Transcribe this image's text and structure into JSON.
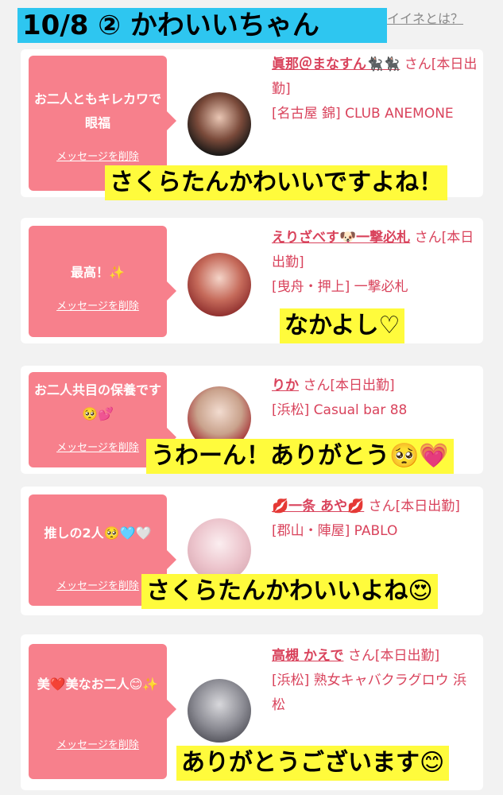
{
  "header": {
    "title": "10/8 ② かわいいちゃん",
    "help_link": "イイネとは？"
  },
  "cards": [
    {
      "message": "お二人ともキレカワで眼福",
      "delete_label": "メッセージを削除",
      "name": "眞那＠まなすん🐈‍⬛🐈‍⬛",
      "honorific": "さん[本日出勤]",
      "store": "[名古屋 錦] CLUB ANEMONE",
      "overlay": "さくらたんかわいいですよね！"
    },
    {
      "message": "最高！✨",
      "delete_label": "メッセージを削除",
      "name": "えりざべす🐶一撃必札",
      "honorific": "さん[本日出勤]",
      "store": "[曳舟・押上] 一撃必札",
      "overlay": "なかよし♡"
    },
    {
      "message": "お二人共目の保養です🥺💕",
      "delete_label": "メッセージを削除",
      "name": "りか",
      "honorific": "さん[本日出勤]",
      "store": "[浜松] Casual bar 88",
      "overlay": "うわーん！ありがとう🥺💗"
    },
    {
      "message": "推しの2人🥺🩵🤍",
      "delete_label": "メッセージを削除",
      "name": "💋一条 あや💋",
      "honorific": "さん[本日出勤]",
      "store": "[郡山・陣屋] PABLO",
      "overlay": "さくらたんかわいいよね😍"
    },
    {
      "message": "美❤️美なお二人😊✨",
      "delete_label": "メッセージを削除",
      "name": "高槻 かえで",
      "honorific": "さん[本日出勤]",
      "store": "[浜松] 熟女キャバクラグロウ 浜松",
      "overlay": "ありがとうございます😊"
    }
  ],
  "colors": {
    "accent_pink": "#f7808c",
    "name_red": "#d9435c",
    "header_blue": "#2ec6f0",
    "highlight_yellow": "#fffb3c"
  }
}
